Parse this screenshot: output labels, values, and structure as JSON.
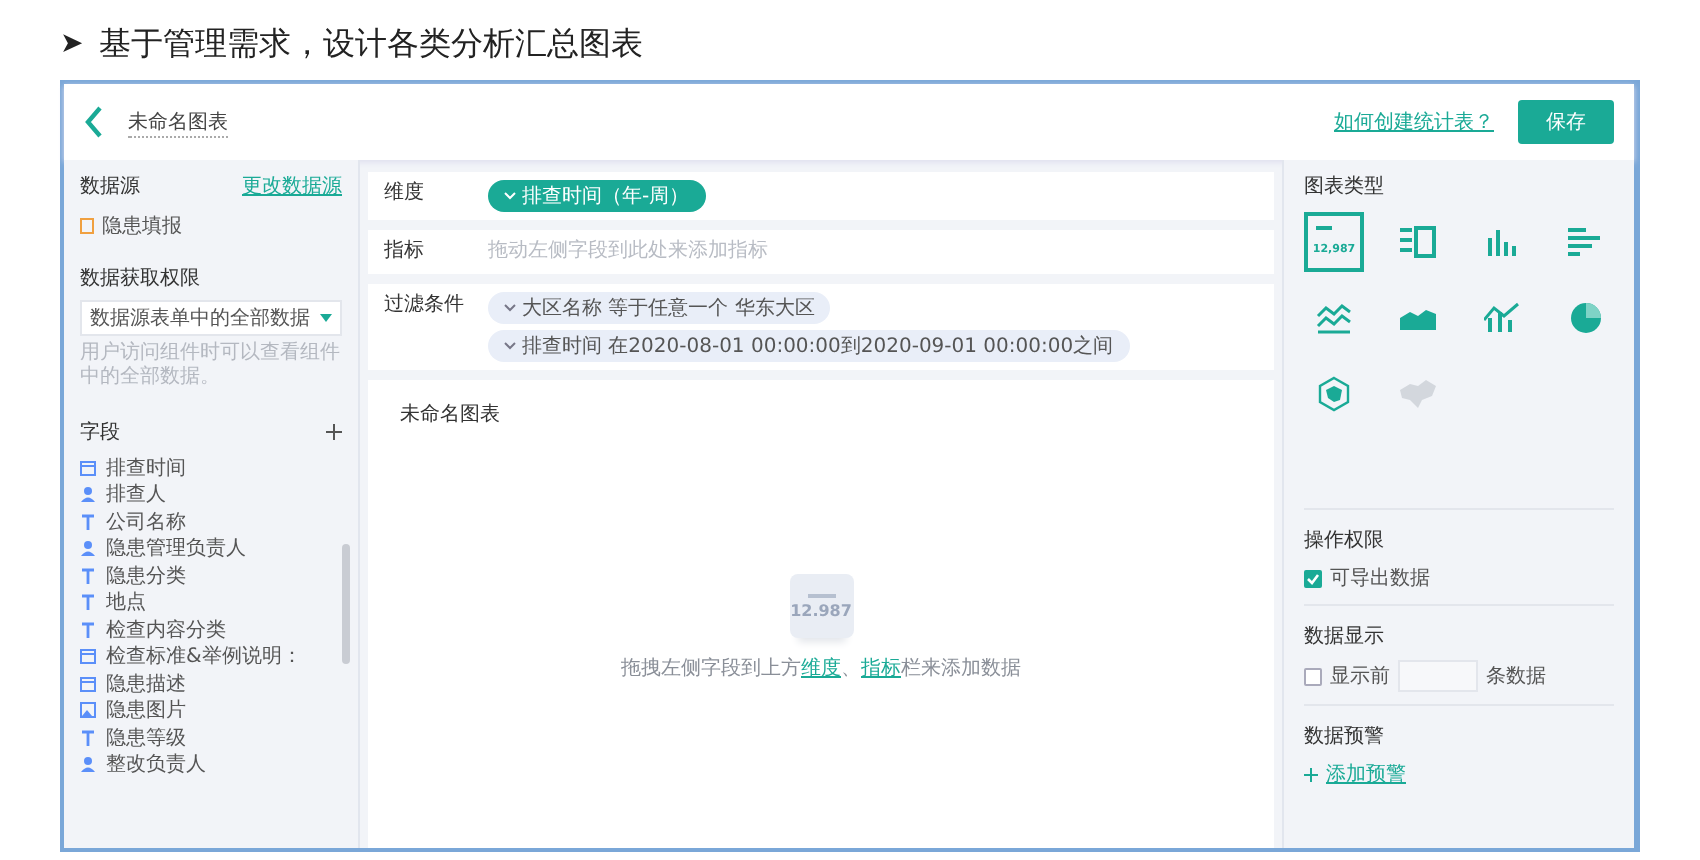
{
  "heading": {
    "bullet": "➤",
    "text": "基于管理需求，设计各类分析汇总图表"
  },
  "topbar": {
    "title": "未命名图表",
    "help_link": "如何创建统计表？",
    "save_button": "保存"
  },
  "sidebar": {
    "source_label": "数据源",
    "change_source": "更改数据源",
    "source_name": "隐患填报",
    "permission_label": "数据获取权限",
    "permission_value": "数据源表单中的全部数据",
    "permission_hint": "用户访问组件时可以查看组件中的全部数据。",
    "fields_label": "字段",
    "fields": [
      {
        "kind": "date",
        "name": "排查时间"
      },
      {
        "kind": "user",
        "name": "排查人"
      },
      {
        "kind": "text",
        "name": "公司名称"
      },
      {
        "kind": "user",
        "name": "隐患管理负责人"
      },
      {
        "kind": "text",
        "name": "隐患分类"
      },
      {
        "kind": "text",
        "name": "地点"
      },
      {
        "kind": "text",
        "name": "检查内容分类"
      },
      {
        "kind": "date",
        "name": "检查标准&举例说明："
      },
      {
        "kind": "date",
        "name": "隐患描述"
      },
      {
        "kind": "image",
        "name": "隐患图片"
      },
      {
        "kind": "text",
        "name": "隐患等级"
      },
      {
        "kind": "user",
        "name": "整改负责人"
      }
    ]
  },
  "config": {
    "dimension_label": "维度",
    "dimension_chip": "排查时间（年-周）",
    "indicator_label": "指标",
    "indicator_placeholder": "拖动左侧字段到此处来添加指标",
    "filter_label": "过滤条件",
    "filters": [
      "大区名称 等于任意一个 华东大区",
      "排查时间 在2020-08-01 00:00:00到2020-09-01 00:00:00之间"
    ]
  },
  "chart_card": {
    "title": "未命名图表",
    "illustration_number": "12.987",
    "hint_before": "拖拽左侧字段到上方",
    "hint_link_1": "维度",
    "hint_sep": "、",
    "hint_link_2": "指标",
    "hint_after": "栏来添加数据"
  },
  "right_panel": {
    "chart_type_label": "图表类型",
    "chart_types": [
      {
        "kind": "number",
        "selected": true,
        "disabled": false,
        "label": "12,987"
      },
      {
        "kind": "table",
        "selected": false,
        "disabled": false
      },
      {
        "kind": "column",
        "selected": false,
        "disabled": false
      },
      {
        "kind": "bar",
        "selected": false,
        "disabled": false
      },
      {
        "kind": "line",
        "selected": false,
        "disabled": false
      },
      {
        "kind": "area",
        "selected": false,
        "disabled": false
      },
      {
        "kind": "combo",
        "selected": false,
        "disabled": false
      },
      {
        "kind": "pie",
        "selected": false,
        "disabled": false
      },
      {
        "kind": "radar",
        "selected": false,
        "disabled": false
      },
      {
        "kind": "map",
        "selected": false,
        "disabled": true
      }
    ],
    "permission_label": "操作权限",
    "export_option": {
      "label": "可导出数据",
      "checked": true
    },
    "display_label": "数据显示",
    "display_option": {
      "label": "显示前",
      "checked": false,
      "suffix": "条数据"
    },
    "alert_label": "数据预警",
    "add_alert": "添加预警"
  }
}
